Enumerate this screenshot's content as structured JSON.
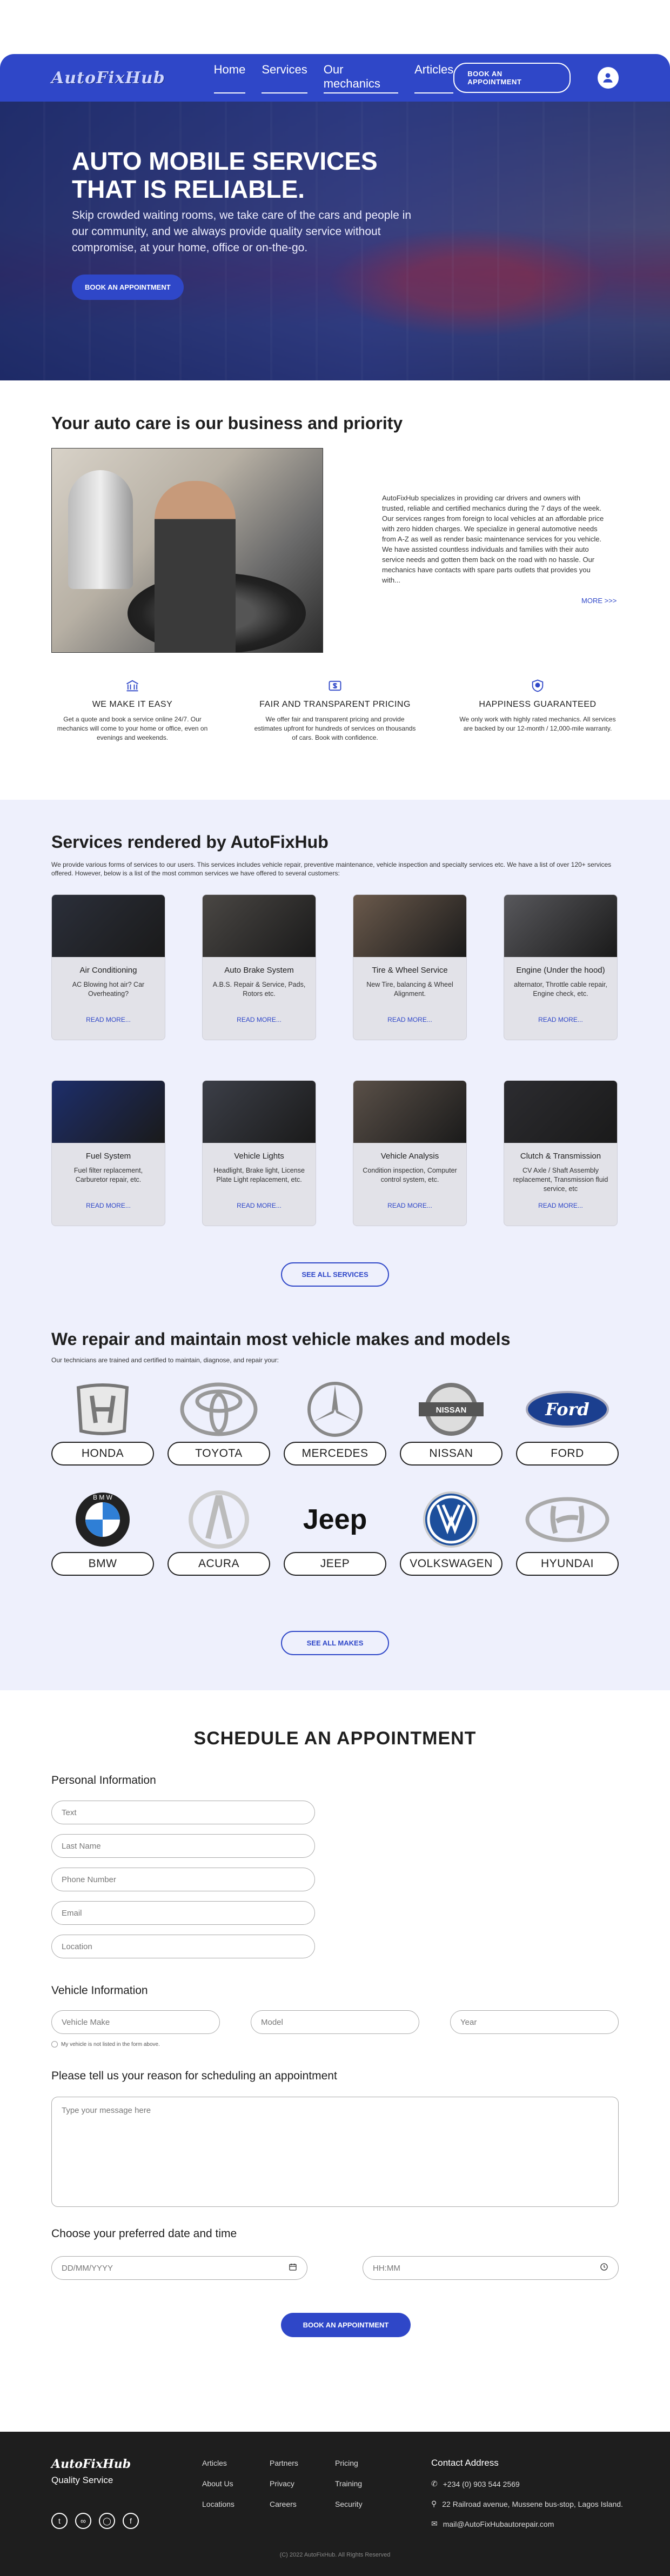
{
  "nav": {
    "logo": "AutoFixHub",
    "links": [
      "Home",
      "Services",
      "Our mechanics",
      "Articles"
    ],
    "appointment_button": "BOOK AN APPOINTMENT"
  },
  "hero": {
    "title": "AUTO MOBILE SERVICES THAT IS RELIABLE.",
    "subtitle": "Skip crowded waiting rooms, we take care of the cars and people in our community, and we always provide quality service without compromise, at your home, office or on-the-go.",
    "button": "BOOK AN APPOINTMENT"
  },
  "about": {
    "title": "Your auto care is our business and priority",
    "text": "AutoFixHub specializes in providing car drivers and owners with trusted, reliable and certified mechanics during the 7 days of the week. Our services ranges from foreign to local vehicles at an affordable price with zero hidden charges. We specialize in general automotive needs from A-Z as well as render basic maintenance services for you vehicle. We have assisted countless individuals and families with their auto service needs and gotten them back on the road with no hassle.  Our mechanics have contacts with spare parts outlets that provides you with...",
    "more": "MORE >>>"
  },
  "features": [
    {
      "icon": "bank-icon",
      "title": "WE MAKE IT EASY",
      "text": "Get a quote and book a service online 24/7. Our mechanics will come to your home or office, even on evenings and weekends."
    },
    {
      "icon": "dollar-icon",
      "title": "FAIR AND TRANSPARENT PRICING",
      "text": "We offer fair and transparent pricing and provide estimates upfront for hundreds of services on thousands of cars. Book with confidence."
    },
    {
      "icon": "shield-icon",
      "title": "HAPPINESS GUARANTEED",
      "text": "We only work with highly rated mechanics. All services are backed by our 12-month / 12,000-mile warranty."
    }
  ],
  "services": {
    "title": "Services rendered by AutoFixHub",
    "intro": "We provide various forms of services to our users. This services includes vehicle repair, preventive maintenance, vehicle inspection and specialty services etc. We have a list of over 120+ services offered. However, below is a list of the most common services we have offered to several customers:",
    "read_more": "READ MORE...",
    "see_all": "SEE ALL SERVICES",
    "items": [
      {
        "title": "Air Conditioning",
        "text": "AC Blowing hot air? Car Overheating?",
        "color": "#2b2f3a"
      },
      {
        "title": "Auto Brake System",
        "text": "A.B.S. Repair & Service, Pads, Rotors etc.",
        "color": "#4a4744"
      },
      {
        "title": "Tire & Wheel Service",
        "text": "New Tire, balancing & Wheel Alignment.",
        "color": "#6b5a4c"
      },
      {
        "title": "Engine (Under the hood)",
        "text": "alternator, Throttle cable repair, Engine check, etc.",
        "color": "#58585c"
      },
      {
        "title": "Fuel System",
        "text": "Fuel filter replacement, Carburetor repair, etc.",
        "color": "#1d2e6b"
      },
      {
        "title": "Vehicle Lights",
        "text": "Headlight, Brake light, License Plate Light replacement, etc.",
        "color": "#3c3f48"
      },
      {
        "title": "Vehicle Analysis",
        "text": "Condition inspection, Computer control system, etc.",
        "color": "#5a5048"
      },
      {
        "title": "Clutch & Transmission",
        "text": "CV Axle / Shaft Assembly replacement, Transmission fluid service, etc",
        "color": "#2c2c30"
      }
    ]
  },
  "makes": {
    "title": "We repair and maintain most vehicle makes and models",
    "intro": "Our technicians are trained and certified to maintain, diagnose, and repair your:",
    "see_all": "SEE ALL MAKES",
    "items": [
      "HONDA",
      "TOYOTA",
      "MERCEDES",
      "NISSAN",
      "FORD",
      "BMW",
      "ACURA",
      "JEEP",
      "VOLKSWAGEN",
      "HYUNDAI"
    ]
  },
  "appointment": {
    "title": "SCHEDULE AN APPOINTMENT",
    "personal_label": "Personal Information",
    "personal_fields": [
      "Text",
      "Last Name",
      "Phone Number",
      "Email",
      "Location"
    ],
    "vehicle_label": "Vehicle Information",
    "vehicle_fields": [
      "Vehicle Make",
      "Model",
      "Year"
    ],
    "vehicle_check": "My vehicle is not listed in the form above.",
    "reason_label": "Please tell us your reason for scheduling an appointment",
    "reason_placeholder": "Type your message here",
    "datetime_label": "Choose your preferred date and time",
    "date_placeholder": "DD/MM/YYYY",
    "time_placeholder": "HH:MM",
    "submit": "BOOK AN APPOINTMENT"
  },
  "footer": {
    "logo": "AutoFixHub",
    "tagline": "Quality Service",
    "col1": [
      "Articles",
      "About Us",
      "Locations"
    ],
    "col2": [
      "Partners",
      "Privacy",
      "Careers"
    ],
    "col3": [
      "Pricing",
      "Training",
      "Security"
    ],
    "contact_title": "Contact Address",
    "phone": "+234 (0) 903 544 2569",
    "address": "22 Railroad avenue, Mussene bus-stop, Lagos Island.",
    "email": "mail@AutoFixHubautorepair.com",
    "copyright": "(C) 2022 AutoFixHub. All Rights Reserved"
  },
  "colors": {
    "brand": "#2f47c8",
    "section_bg": "#eef0fc",
    "footer_bg": "#1e1e1e"
  }
}
